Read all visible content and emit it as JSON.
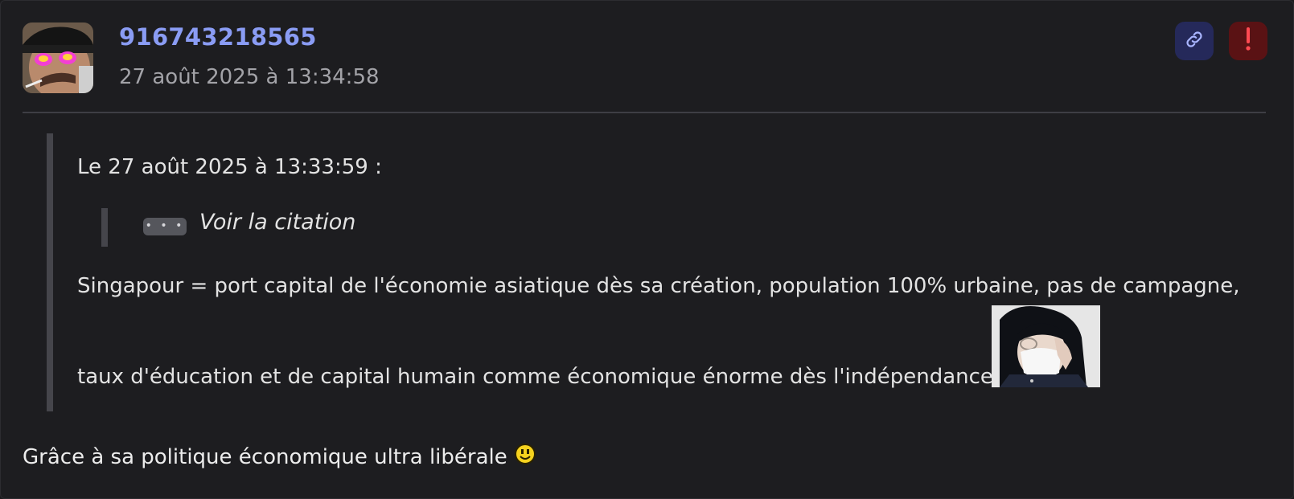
{
  "post": {
    "author": "916743218565",
    "timestamp": "27 août 2025 à 13:34:58",
    "actions": {
      "link_icon": "link-icon",
      "report_icon": "exclamation-icon",
      "link_color": "#25295a",
      "report_color": "#5a1214"
    },
    "quote": {
      "header": "Le 27 août 2025 à 13:33:59 :",
      "nested_toggle": "• • •",
      "nested_label": "Voir la citation",
      "line1": "Singapour = port capital de l'économie asiatique dès sa création, population 100% urbaine, pas de campagne,",
      "line2": "taux d'éducation et de capital humain comme économique énorme dès l'indépendance"
    },
    "body": "Grâce à sa politique économique ultra libérale",
    "accent_color": "#8a9cf4"
  }
}
